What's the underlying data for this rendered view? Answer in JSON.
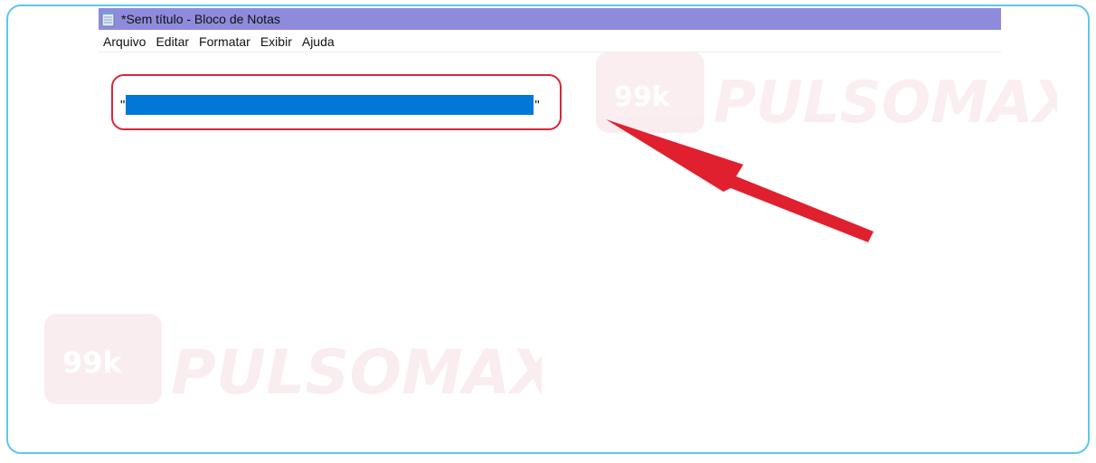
{
  "window": {
    "title": "*Sem título - Bloco de Notas"
  },
  "menu": {
    "items": [
      "Arquivo",
      "Editar",
      "Formatar",
      "Exibir",
      "Ajuda"
    ]
  },
  "editor": {
    "open_quote": "\"",
    "close_quote": "\""
  },
  "watermark": {
    "brand": "PULSOMAX",
    "badge": "99k"
  },
  "colors": {
    "titlebar": "#8f8bdc",
    "selection": "#0078d7",
    "annotation": "#e0202e",
    "frame": "#5ec8ec"
  },
  "icons": {
    "app": "notepad-icon"
  }
}
